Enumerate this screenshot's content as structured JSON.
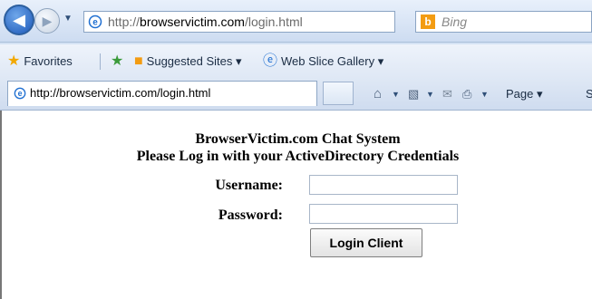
{
  "address_bar": {
    "url_prefix": "http://",
    "url_domain": "browservictim.com",
    "url_path": "/login.html"
  },
  "search": {
    "placeholder": "Bing"
  },
  "favorites_bar": {
    "favorites_label": "Favorites",
    "suggested_sites_label": "Suggested Sites ▾",
    "web_slice_label": "Web Slice Gallery ▾"
  },
  "tab": {
    "label": "http://browservictim.com/login.html"
  },
  "command_bar": {
    "page_label": "Page ▾",
    "s_label": "S"
  },
  "page": {
    "title_line1": "BrowserVictim.com Chat System",
    "title_line2": "Please Log in with your ActiveDirectory Credentials",
    "username_label": "Username:",
    "password_label": "Password:",
    "login_button": "Login Client"
  }
}
